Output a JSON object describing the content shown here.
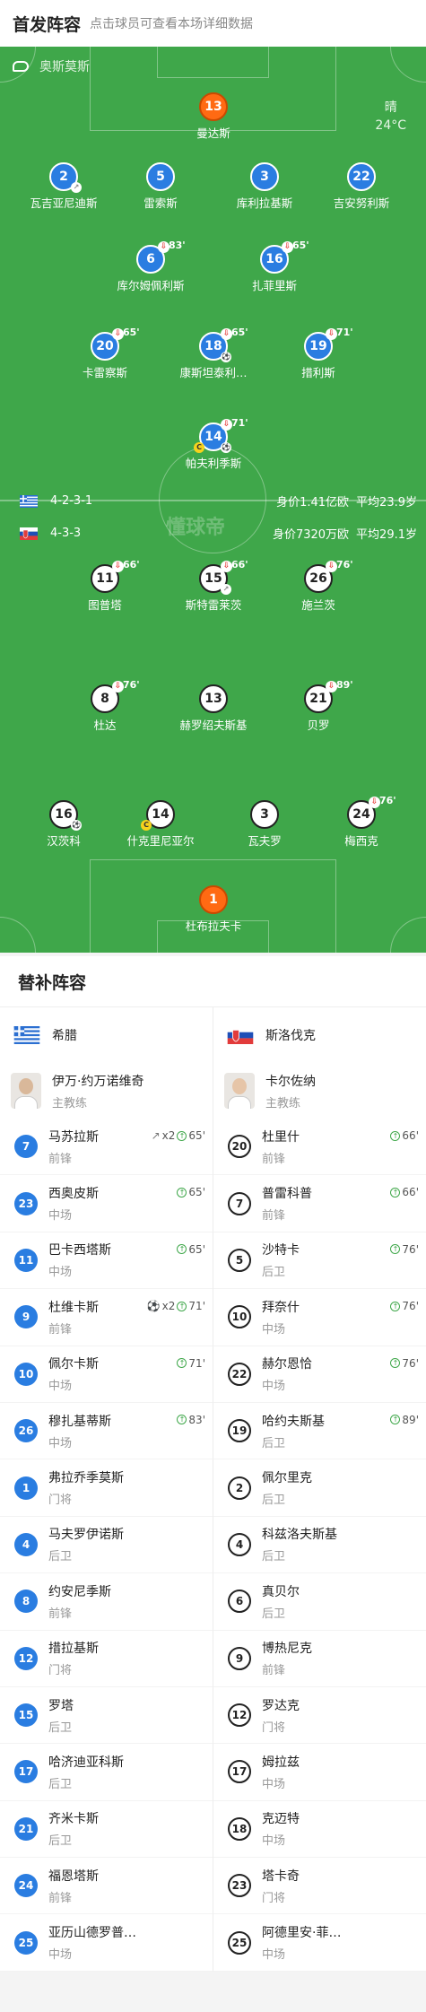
{
  "header": {
    "title": "首发阵容",
    "subtitle": "点击球员可查看本场详细数据"
  },
  "referee": "奥斯莫斯",
  "weather": {
    "cond": "晴",
    "temp": "24°C"
  },
  "home_team": {
    "formation": "4-2-3-1",
    "value": "身价1.41亿欧",
    "age": "平均23.9岁"
  },
  "away_team": {
    "formation": "4-3-3",
    "value": "身价7320万欧",
    "age": "平均29.1岁"
  },
  "watermark": "懂球帝",
  "home_players": [
    {
      "num": "13",
      "name": "曼达斯",
      "style": "orange"
    },
    {
      "num": "2",
      "name": "瓦吉亚尼迪斯",
      "style": "blue",
      "badge": "shoe"
    },
    {
      "num": "5",
      "name": "雷索斯",
      "style": "blue"
    },
    {
      "num": "3",
      "name": "库利拉基斯",
      "style": "blue"
    },
    {
      "num": "22",
      "name": "吉安努利斯",
      "style": "blue"
    },
    {
      "num": "6",
      "name": "库尔姆佩利斯",
      "style": "blue",
      "sub": "83'"
    },
    {
      "num": "16",
      "name": "扎菲里斯",
      "style": "blue",
      "sub": "65'"
    },
    {
      "num": "20",
      "name": "卡雷察斯",
      "style": "blue",
      "sub": "65'"
    },
    {
      "num": "18",
      "name": "康斯坦泰利…",
      "style": "blue",
      "sub": "65'",
      "badge": "ball"
    },
    {
      "num": "19",
      "name": "措利斯",
      "style": "blue",
      "sub": "71'"
    },
    {
      "num": "14",
      "name": "帕夫利季斯",
      "style": "blue",
      "sub": "71'",
      "cap": true,
      "badge": "ball2"
    }
  ],
  "away_players": [
    {
      "num": "11",
      "name": "图普塔",
      "style": "white",
      "sub": "66'"
    },
    {
      "num": "15",
      "name": "斯特雷莱茨",
      "style": "white",
      "sub": "66'",
      "badge": "shoe"
    },
    {
      "num": "26",
      "name": "施兰茨",
      "style": "white",
      "sub": "76'"
    },
    {
      "num": "8",
      "name": "杜达",
      "style": "white",
      "sub": "76'"
    },
    {
      "num": "13",
      "name": "赫罗绍夫斯基",
      "style": "white"
    },
    {
      "num": "21",
      "name": "贝罗",
      "style": "white",
      "sub": "89'"
    },
    {
      "num": "16",
      "name": "汉茨科",
      "style": "white",
      "badge": "ball"
    },
    {
      "num": "14",
      "name": "什克里尼亚尔",
      "style": "white",
      "cap": true
    },
    {
      "num": "3",
      "name": "瓦夫罗",
      "style": "white"
    },
    {
      "num": "24",
      "name": "梅西克",
      "style": "white",
      "sub": "76'"
    },
    {
      "num": "1",
      "name": "杜布拉夫卡",
      "style": "orange"
    }
  ],
  "subs_title": "替补阵容",
  "home": {
    "name": "希腊",
    "coach": {
      "name": "伊万·约万诺维奇",
      "role": "主教练"
    }
  },
  "away": {
    "name": "斯洛伐克",
    "coach": {
      "name": "卡尔佐纳",
      "role": "主教练"
    }
  },
  "home_subs": [
    {
      "num": "7",
      "name": "马苏拉斯",
      "pos": "前锋",
      "ev": "x2",
      "time": "65'",
      "evicon": "shoe"
    },
    {
      "num": "23",
      "name": "西奥皮斯",
      "pos": "中场",
      "time": "65'"
    },
    {
      "num": "11",
      "name": "巴卡西塔斯",
      "pos": "中场",
      "time": "65'"
    },
    {
      "num": "9",
      "name": "杜维卡斯",
      "pos": "前锋",
      "ev": "x2",
      "time": "71'",
      "evicon": "ball"
    },
    {
      "num": "10",
      "name": "佩尔卡斯",
      "pos": "中场",
      "time": "71'"
    },
    {
      "num": "26",
      "name": "穆扎基蒂斯",
      "pos": "中场",
      "time": "83'"
    },
    {
      "num": "1",
      "name": "弗拉乔季莫斯",
      "pos": "门将"
    },
    {
      "num": "4",
      "name": "马夫罗伊诺斯",
      "pos": "后卫"
    },
    {
      "num": "8",
      "name": "约安尼季斯",
      "pos": "前锋"
    },
    {
      "num": "12",
      "name": "措拉基斯",
      "pos": "门将"
    },
    {
      "num": "15",
      "name": "罗塔",
      "pos": "后卫"
    },
    {
      "num": "17",
      "name": "哈济迪亚科斯",
      "pos": "后卫"
    },
    {
      "num": "21",
      "name": "齐米卡斯",
      "pos": "后卫"
    },
    {
      "num": "24",
      "name": "福恩塔斯",
      "pos": "前锋"
    },
    {
      "num": "25",
      "name": "亚历山德罗普…",
      "pos": "中场"
    }
  ],
  "away_subs": [
    {
      "num": "20",
      "name": "杜里什",
      "pos": "前锋",
      "time": "66'"
    },
    {
      "num": "7",
      "name": "普雷科普",
      "pos": "前锋",
      "time": "66'"
    },
    {
      "num": "5",
      "name": "沙特卡",
      "pos": "后卫",
      "time": "76'"
    },
    {
      "num": "10",
      "name": "拜奈什",
      "pos": "中场",
      "time": "76'"
    },
    {
      "num": "22",
      "name": "赫尔恩恰",
      "pos": "中场",
      "time": "76'"
    },
    {
      "num": "19",
      "name": "哈约夫斯基",
      "pos": "后卫",
      "time": "89'"
    },
    {
      "num": "2",
      "name": "佩尔里克",
      "pos": "后卫"
    },
    {
      "num": "4",
      "name": "科兹洛夫斯基",
      "pos": "后卫"
    },
    {
      "num": "6",
      "name": "真贝尔",
      "pos": "后卫"
    },
    {
      "num": "9",
      "name": "博热尼克",
      "pos": "前锋"
    },
    {
      "num": "12",
      "name": "罗达克",
      "pos": "门将"
    },
    {
      "num": "17",
      "name": "姆拉兹",
      "pos": "中场"
    },
    {
      "num": "18",
      "name": "克迈特",
      "pos": "中场"
    },
    {
      "num": "23",
      "name": "塔卡奇",
      "pos": "门将"
    },
    {
      "num": "25",
      "name": "阿德里安·菲…",
      "pos": "中场"
    }
  ]
}
